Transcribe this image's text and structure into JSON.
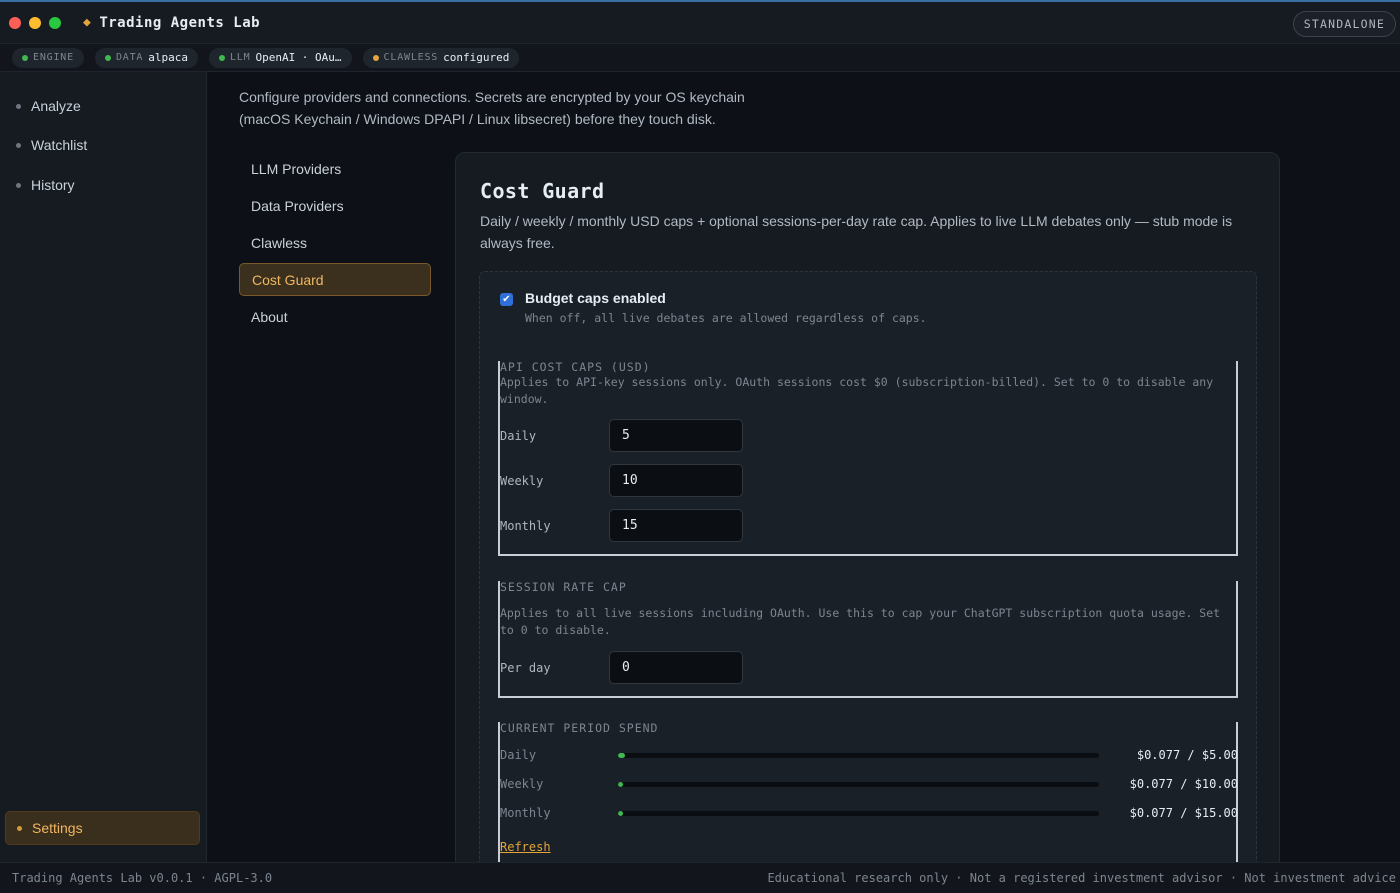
{
  "window": {
    "title": "Trading Agents Lab",
    "mode_badge": "STANDALONE"
  },
  "status": {
    "chips": [
      {
        "label": "ENGINE",
        "value": "",
        "dot_color": "#3fb950"
      },
      {
        "label": "DATA",
        "value": "alpaca",
        "dot_color": "#3fb950"
      },
      {
        "label": "LLM",
        "value": "OpenAI · OAu…",
        "dot_color": "#3fb950"
      },
      {
        "label": "CLAWLESS",
        "value": "configured",
        "dot_color": "#e3a53b"
      }
    ]
  },
  "sidebar": {
    "items": [
      {
        "label": "Analyze"
      },
      {
        "label": "Watchlist"
      },
      {
        "label": "History"
      }
    ],
    "bottom_item": {
      "label": "Settings"
    }
  },
  "settings": {
    "intro": "Configure providers and connections. Secrets are encrypted by your OS keychain (macOS Keychain / Windows DPAPI / Linux libsecret) before they touch disk.",
    "subnav": [
      {
        "label": "LLM Providers"
      },
      {
        "label": "Data Providers"
      },
      {
        "label": "Clawless"
      },
      {
        "label": "Cost Guard"
      },
      {
        "label": "About"
      }
    ],
    "active_subnav": "Cost Guard"
  },
  "cost_guard": {
    "title": "Cost Guard",
    "description": "Daily / weekly / monthly USD caps + optional sessions-per-day rate cap. Applies to live LLM debates only — stub mode is always free.",
    "enabled_label": "Budget caps enabled",
    "enabled_hint": "When off, all live debates are allowed regardless of caps.",
    "enabled": true,
    "api_caps": {
      "legend": "API COST CAPS (USD)",
      "help": "Applies to API-key sessions only. OAuth sessions cost $0 (subscription-billed). Set to 0 to disable any window.",
      "fields": [
        {
          "label": "Daily",
          "value": "5"
        },
        {
          "label": "Weekly",
          "value": "10"
        },
        {
          "label": "Monthly",
          "value": "15"
        }
      ]
    },
    "rate_cap": {
      "legend": "SESSION RATE CAP",
      "help": "Applies to all live sessions including OAuth. Use this to cap your ChatGPT subscription quota usage. Set to 0 to disable.",
      "field": {
        "label": "Per day",
        "value": "0"
      }
    },
    "spend": {
      "legend": "CURRENT PERIOD SPEND",
      "rows": [
        {
          "label": "Daily",
          "text": "$0.077 / $5.00",
          "fraction": 0.0154
        },
        {
          "label": "Weekly",
          "text": "$0.077 / $10.00",
          "fraction": 0.0077
        },
        {
          "label": "Monthly",
          "text": "$0.077 / $15.00",
          "fraction": 0.0051
        }
      ],
      "refresh_label": "Refresh"
    }
  },
  "footer": {
    "left": "Trading Agents Lab v0.0.1 · AGPL-3.0",
    "right": "Educational research only · Not a registered investment advisor · Not investment advice"
  },
  "colors": {
    "accent": "#e3a53b",
    "ok": "#3fb950",
    "checkbox": "#2f6fd8"
  }
}
